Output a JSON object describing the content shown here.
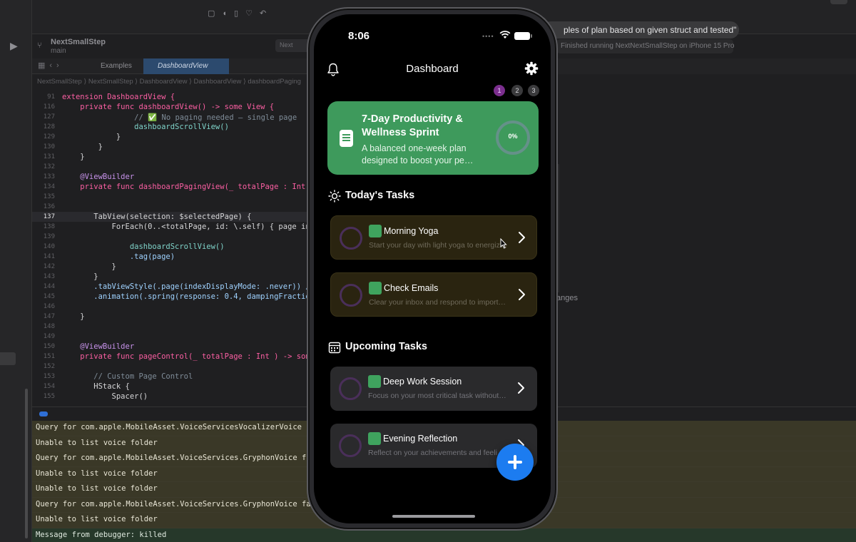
{
  "xcode": {
    "scheme_name": "NextSmallStep",
    "branch": "main",
    "destination_chip": "Next",
    "status": "Finished running NextNextSmallStep on iPhone 15 Pro",
    "chat_message": "ples of plan based on given struct and tested\"",
    "tabs": [
      "Examples",
      "DashboardView"
    ],
    "breadcrumb": "NextSmallStep ⟩  NextSmallStep ⟩  DashboardView ⟩  DashboardView ⟩  dashboardPaging",
    "right_note": "anges",
    "code_lines": [
      {
        "n": "91",
        "t": "extension DashboardView {"
      },
      {
        "n": "116",
        "t": "    private func dashboardView() -> some View {"
      },
      {
        "n": "127",
        "t": "                // ✅ No paging needed — single page"
      },
      {
        "n": "128",
        "t": "                dashboardScrollView()"
      },
      {
        "n": "129",
        "t": "            }"
      },
      {
        "n": "130",
        "t": "        }"
      },
      {
        "n": "131",
        "t": "    }"
      },
      {
        "n": "132",
        "t": ""
      },
      {
        "n": "133",
        "t": "    @ViewBuilder"
      },
      {
        "n": "134",
        "t": "    private func dashboardPagingView(_ totalPage : Int) ->"
      },
      {
        "n": "135",
        "t": ""
      },
      {
        "n": "136",
        "t": ""
      },
      {
        "n": "137",
        "t": "       TabView(selection: $selectedPage) {"
      },
      {
        "n": "138",
        "t": "           ForEach(0..<totalPage, id: \\.self) { page in"
      },
      {
        "n": "139",
        "t": ""
      },
      {
        "n": "140",
        "t": "               dashboardScrollView()"
      },
      {
        "n": "141",
        "t": "               .tag(page)"
      },
      {
        "n": "142",
        "t": "           }"
      },
      {
        "n": "143",
        "t": "       }"
      },
      {
        "n": "144",
        "t": "       .tabViewStyle(.page(indexDisplayMode: .never)) //"
      },
      {
        "n": "145",
        "t": "       .animation(.spring(response: 0.4, dampingFraction"
      },
      {
        "n": "146",
        "t": ""
      },
      {
        "n": "147",
        "t": "    }"
      },
      {
        "n": "148",
        "t": ""
      },
      {
        "n": "149",
        "t": ""
      },
      {
        "n": "150",
        "t": "    @ViewBuilder"
      },
      {
        "n": "151",
        "t": "    private func pageControl(_ totalPage : Int ) -> some"
      },
      {
        "n": "152",
        "t": ""
      },
      {
        "n": "153",
        "t": "       // Custom Page Control"
      },
      {
        "n": "154",
        "t": "       HStack {"
      },
      {
        "n": "155",
        "t": "           Spacer()"
      }
    ],
    "console": [
      "Query for com.apple.MobileAsset.VoiceServicesVocalizerVoice fai",
      "Unable to list voice folder",
      "Query for com.apple.MobileAsset.VoiceServices.GryphonVoice fai",
      "Unable to list voice folder",
      "Unable to list voice folder",
      "Query for com.apple.MobileAsset.VoiceServices.GryphonVoice fai",
      "Unable to list voice folder",
      "Message from debugger: killed"
    ]
  },
  "phone": {
    "time": "8:06",
    "title": "Dashboard",
    "pages": [
      "1",
      "2",
      "3"
    ],
    "plan": {
      "title": "7-Day Productivity & Wellness Sprint",
      "description": "A balanced one-week plan designed to boost your pe…",
      "progress_label": "0%",
      "progress": 0,
      "color": "#3e9a5c"
    },
    "today_section": "Today's Tasks",
    "upcoming_section": "Upcoming Tasks",
    "today_tasks": [
      {
        "name": "Morning Yoga",
        "description": "Start your day with light yoga to energiz…"
      },
      {
        "name": "Check Emails",
        "description": "Clear your inbox and respond to importa…"
      }
    ],
    "upcoming_tasks": [
      {
        "name": "Deep Work Session",
        "description": "Focus on your most critical task without i…"
      },
      {
        "name": "Evening Reflection",
        "description": "Reflect on your achievements and feelings"
      }
    ],
    "accent": "#1c7cf0",
    "ring_color": "#4a2f5a"
  }
}
